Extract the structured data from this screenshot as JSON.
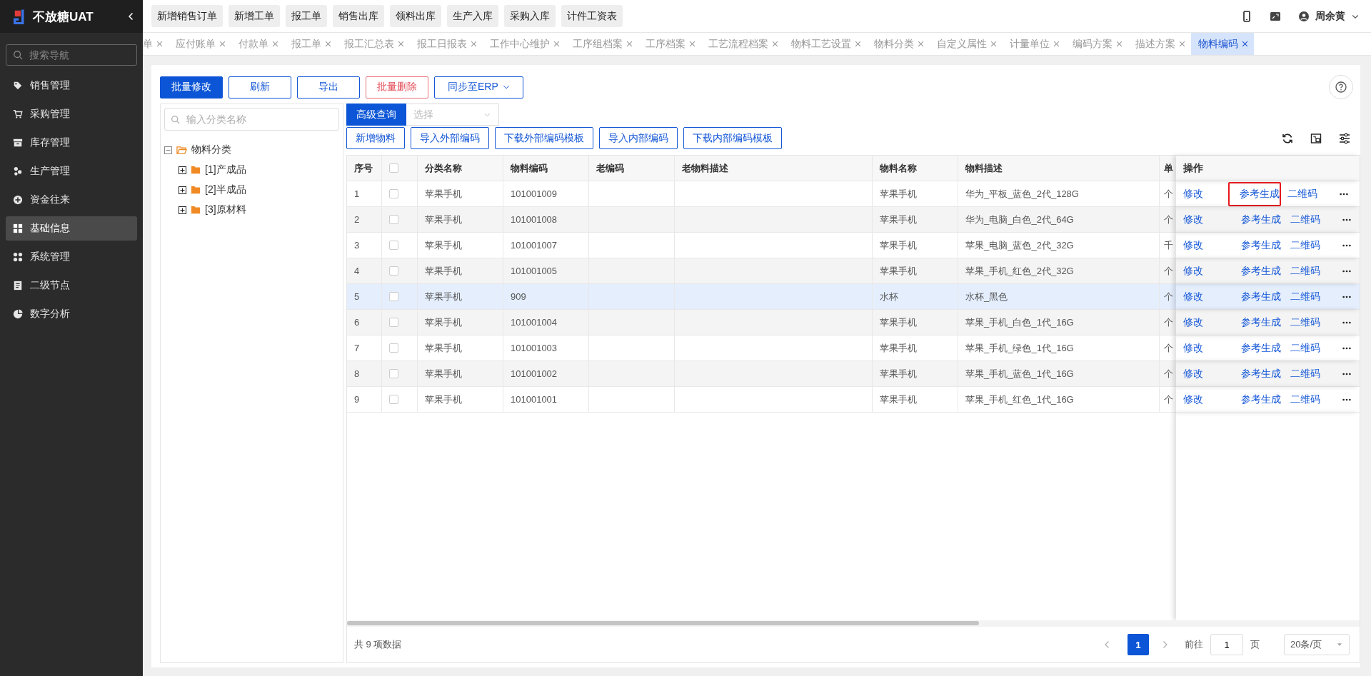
{
  "sidebar": {
    "logo_text": "不放糖UAT",
    "search": {
      "placeholder": "搜索导航"
    },
    "items": [
      {
        "label": "销售管理",
        "selected": false
      },
      {
        "label": "采购管理",
        "selected": false
      },
      {
        "label": "库存管理",
        "selected": false
      },
      {
        "label": "生产管理",
        "selected": false
      },
      {
        "label": "资金往来",
        "selected": false
      },
      {
        "label": "基础信息",
        "selected": true
      },
      {
        "label": "系统管理",
        "selected": false
      },
      {
        "label": "二级节点",
        "selected": false
      },
      {
        "label": "数字分析",
        "selected": false
      }
    ]
  },
  "quick_actions": [
    "新增销售订单",
    "新增工单",
    "报工单",
    "销售出库",
    "领料出库",
    "生产入库",
    "采购入库",
    "计件工资表"
  ],
  "header": {
    "user_name": "周余黄"
  },
  "tabs": [
    {
      "label": "单",
      "selected": false
    },
    {
      "label": "应付账单",
      "selected": false
    },
    {
      "label": "付款单",
      "selected": false
    },
    {
      "label": "报工单",
      "selected": false
    },
    {
      "label": "报工汇总表",
      "selected": false
    },
    {
      "label": "报工日报表",
      "selected": false
    },
    {
      "label": "工作中心维护",
      "selected": false
    },
    {
      "label": "工序组档案",
      "selected": false
    },
    {
      "label": "工序档案",
      "selected": false
    },
    {
      "label": "工艺流程档案",
      "selected": false
    },
    {
      "label": "物料工艺设置",
      "selected": false
    },
    {
      "label": "物料分类",
      "selected": false
    },
    {
      "label": "自定义属性",
      "selected": false
    },
    {
      "label": "计量单位",
      "selected": false
    },
    {
      "label": "编码方案",
      "selected": false
    },
    {
      "label": "描述方案",
      "selected": false
    },
    {
      "label": "物料编码",
      "selected": true
    }
  ],
  "toolbar": [
    {
      "label": "批量修改",
      "kind": "primary"
    },
    {
      "label": "刷新",
      "kind": "default"
    },
    {
      "label": "导出",
      "kind": "default"
    },
    {
      "label": "批量删除",
      "kind": "danger"
    },
    {
      "label": "同步至ERP",
      "kind": "dropdown"
    }
  ],
  "category_tree": {
    "search": {
      "placeholder": "输入分类名称"
    },
    "root": {
      "label": "物料分类",
      "expanded": true,
      "children": [
        {
          "label": "[1]产成品",
          "expanded": false
        },
        {
          "label": "[2]半成品",
          "expanded": false
        },
        {
          "label": "[3]原材料",
          "expanded": false
        }
      ]
    }
  },
  "query": {
    "button": "高级查询",
    "select": {
      "placeholder": "选择"
    }
  },
  "actions": [
    "新增物料",
    "导入外部编码",
    "下载外部编码模板",
    "导入内部编码",
    "下载内部编码模板"
  ],
  "table": {
    "columns": [
      "序号",
      "分类名称",
      "物料编码",
      "老编码",
      "老物料描述",
      "物料名称",
      "物料描述",
      "单"
    ],
    "select_all_checked": false,
    "action_column": "操作",
    "rows": [
      {
        "index": "1",
        "checked": false,
        "selected": false,
        "category": "苹果手机",
        "code": "101001009",
        "name": "苹果手机",
        "description": "华为_平板_蓝色_2代_128G",
        "unit": "个",
        "actions": [
          "修改",
          "参考生成",
          "二维码"
        ],
        "boxed_action": true
      },
      {
        "index": "2",
        "checked": false,
        "selected": false,
        "category": "苹果手机",
        "code": "101001008",
        "name": "苹果手机",
        "description": "华为_电脑_白色_2代_64G",
        "unit": "个",
        "actions": [
          "修改",
          "参考生成",
          "二维码"
        ],
        "boxed_action": false
      },
      {
        "index": "3",
        "checked": false,
        "selected": false,
        "category": "苹果手机",
        "code": "101001007",
        "name": "苹果手机",
        "description": "苹果_电脑_蓝色_2代_32G",
        "unit": "千",
        "actions": [
          "修改",
          "参考生成",
          "二维码"
        ],
        "boxed_action": false
      },
      {
        "index": "4",
        "checked": false,
        "selected": false,
        "category": "苹果手机",
        "code": "101001005",
        "name": "苹果手机",
        "description": "苹果_手机_红色_2代_32G",
        "unit": "个",
        "actions": [
          "修改",
          "参考生成",
          "二维码"
        ],
        "boxed_action": false
      },
      {
        "index": "5",
        "checked": false,
        "selected": true,
        "category": "苹果手机",
        "code": "909",
        "name": "水杯",
        "description": "水杯_黑色",
        "unit": "个",
        "actions": [
          "修改",
          "参考生成",
          "二维码"
        ],
        "boxed_action": false
      },
      {
        "index": "6",
        "checked": false,
        "selected": false,
        "category": "苹果手机",
        "code": "101001004",
        "name": "苹果手机",
        "description": "苹果_手机_白色_1代_16G",
        "unit": "个",
        "actions": [
          "修改",
          "参考生成",
          "二维码"
        ],
        "boxed_action": false
      },
      {
        "index": "7",
        "checked": false,
        "selected": false,
        "category": "苹果手机",
        "code": "101001003",
        "name": "苹果手机",
        "description": "苹果_手机_绿色_1代_16G",
        "unit": "个",
        "actions": [
          "修改",
          "参考生成",
          "二维码"
        ],
        "boxed_action": false
      },
      {
        "index": "8",
        "checked": false,
        "selected": false,
        "category": "苹果手机",
        "code": "101001002",
        "name": "苹果手机",
        "description": "苹果_手机_蓝色_1代_16G",
        "unit": "个",
        "actions": [
          "修改",
          "参考生成",
          "二维码"
        ],
        "boxed_action": false
      },
      {
        "index": "9",
        "checked": false,
        "selected": false,
        "category": "苹果手机",
        "code": "101001001",
        "name": "苹果手机",
        "description": "苹果_手机_红色_1代_16G",
        "unit": "个",
        "actions": [
          "修改",
          "参考生成",
          "二维码"
        ],
        "boxed_action": false
      }
    ]
  },
  "pagination": {
    "total": "共 9 项数据",
    "pages": [
      {
        "label": "1",
        "selected": true
      }
    ],
    "goto_label": "前往",
    "goto_value": "1",
    "page_unit": "页",
    "page_size": "20条/页"
  }
}
